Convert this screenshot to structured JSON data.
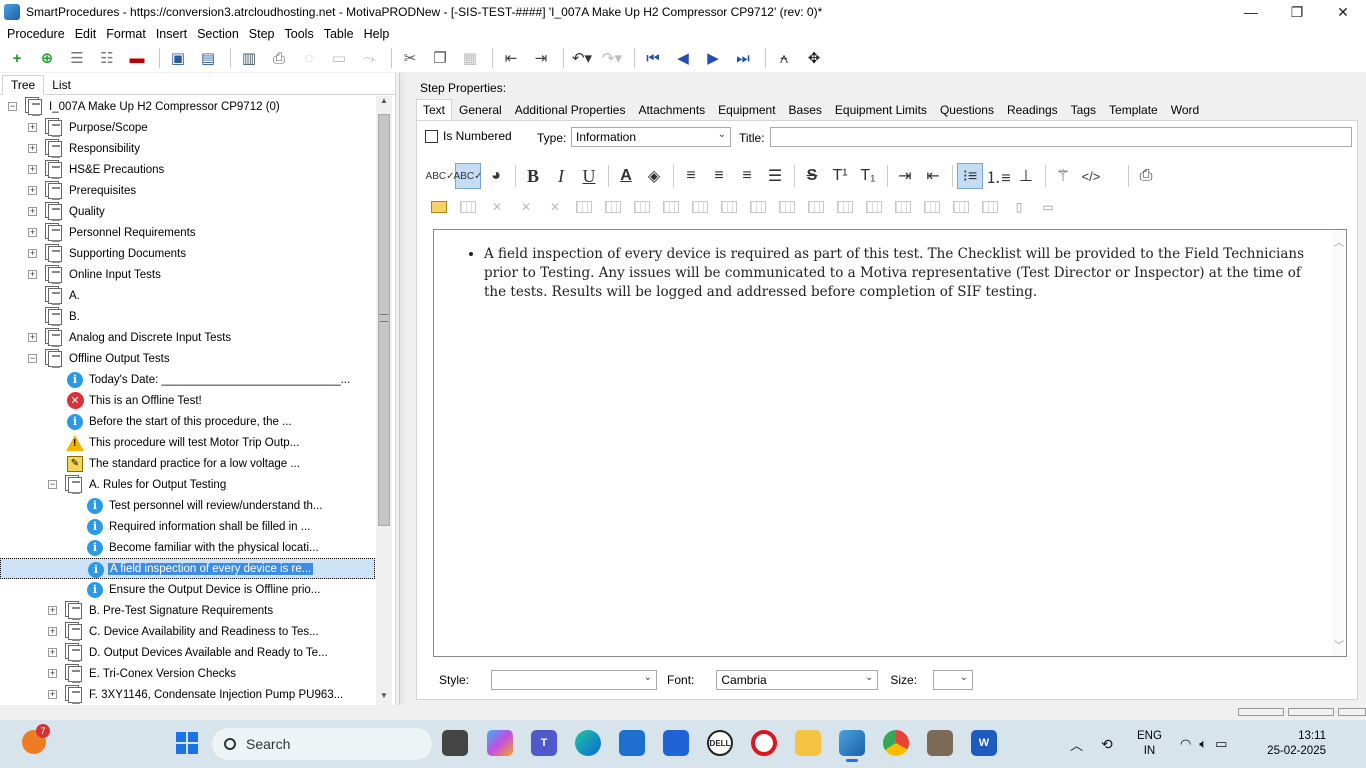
{
  "window": {
    "title": "SmartProcedures - https://conversion3.atrcloudhosting.net - MotivaPRODNew - [-SIS-TEST-####] 'I_007A Make Up H2 Compressor CP9712' (rev: 0)*",
    "minimize": "—",
    "maximize": "❐",
    "close": "✕"
  },
  "menu": [
    "Procedure",
    "Edit",
    "Format",
    "Insert",
    "Section",
    "Step",
    "Tools",
    "Table",
    "Help"
  ],
  "left_pane": {
    "tabs": [
      "Tree",
      "List"
    ],
    "tree": [
      {
        "label": "I_007A Make Up H2 Compressor CP9712 (0)",
        "level": 0,
        "expander": "−",
        "icon": "procedure-icon"
      },
      {
        "label": "Purpose/Scope",
        "level": 1,
        "expander": "+",
        "icon": "section-icon"
      },
      {
        "label": "Responsibility",
        "level": 1,
        "expander": "+",
        "icon": "section-icon"
      },
      {
        "label": "HS&E Precautions",
        "level": 1,
        "expander": "+",
        "icon": "section-icon"
      },
      {
        "label": "Prerequisites",
        "level": 1,
        "expander": "+",
        "icon": "section-icon"
      },
      {
        "label": "Quality",
        "level": 1,
        "expander": "+",
        "icon": "section-icon"
      },
      {
        "label": "Personnel Requirements",
        "level": 1,
        "expander": "+",
        "icon": "section-icon"
      },
      {
        "label": "Supporting Documents",
        "level": 1,
        "expander": "+",
        "icon": "section-icon"
      },
      {
        "label": "Online Input Tests",
        "level": 1,
        "expander": "+",
        "icon": "section-icon"
      },
      {
        "label": "A.",
        "level": 1,
        "expander": "",
        "icon": "section-icon"
      },
      {
        "label": "B.",
        "level": 1,
        "expander": "",
        "icon": "section-icon"
      },
      {
        "label": "Analog and Discrete Input Tests",
        "level": 1,
        "expander": "+",
        "icon": "section-icon"
      },
      {
        "label": "Offline Output Tests",
        "level": 1,
        "expander": "−",
        "icon": "section-icon"
      },
      {
        "label": "Today's Date: ____________________________...",
        "level": 2,
        "expander": "",
        "icon": "info-icon"
      },
      {
        "label": "This is an Offline Test!",
        "level": 2,
        "expander": "",
        "icon": "error-icon"
      },
      {
        "label": "Before the start of this procedure, the ...",
        "level": 2,
        "expander": "",
        "icon": "info-icon"
      },
      {
        "label": "This procedure will test Motor Trip Outp...",
        "level": 2,
        "expander": "",
        "icon": "warning-icon"
      },
      {
        "label": "The standard practice for a low voltage ...",
        "level": 2,
        "expander": "",
        "icon": "tip-icon"
      },
      {
        "label": "A. Rules for Output Testing",
        "level": 2,
        "expander": "−",
        "icon": "section-icon"
      },
      {
        "label": "Test personnel will review/understand th...",
        "level": 3,
        "expander": "",
        "icon": "info-icon"
      },
      {
        "label": "Required information shall be filled in ...",
        "level": 3,
        "expander": "",
        "icon": "info-icon"
      },
      {
        "label": "Become familiar with the physical locati...",
        "level": 3,
        "expander": "",
        "icon": "info-icon"
      },
      {
        "label": "A field inspection of every device is re...",
        "level": 3,
        "expander": "",
        "icon": "info-icon",
        "selected": true
      },
      {
        "label": "Ensure the Output Device is Offline prio...",
        "level": 3,
        "expander": "",
        "icon": "info-icon"
      },
      {
        "label": "B. Pre-Test Signature Requirements",
        "level": 2,
        "expander": "+",
        "icon": "section-icon"
      },
      {
        "label": "C. Device Availability and Readiness to Tes...",
        "level": 2,
        "expander": "+",
        "icon": "section-icon"
      },
      {
        "label": "D. Output Devices Available and Ready to Te...",
        "level": 2,
        "expander": "+",
        "icon": "section-icon"
      },
      {
        "label": "E. Tri-Conex Version Checks",
        "level": 2,
        "expander": "+",
        "icon": "section-icon"
      },
      {
        "label": "F. 3XY1146, Condensate Injection Pump PU963...",
        "level": 2,
        "expander": "+",
        "icon": "section-icon"
      }
    ]
  },
  "right_pane": {
    "heading": "Step Properties:",
    "tabs": [
      "Text",
      "General",
      "Additional Properties",
      "Attachments",
      "Equipment",
      "Bases",
      "Equipment Limits",
      "Questions",
      "Readings",
      "Tags",
      "Template",
      "Word"
    ],
    "active_tab": "Text",
    "is_numbered_label": "Is Numbered",
    "type_label": "Type:",
    "type_value": "Information",
    "title_label": "Title:",
    "title_value": "",
    "editor_text": "A field inspection of every device is required as part of this test. The Checklist will be provided to the Field Technicians prior to Testing. Any issues will be communicated to a Motiva representative (Test Director or Inspector) at the time of the tests. Results will be logged and addressed before completion of SIF testing.",
    "style_label": "Style:",
    "style_value": "",
    "font_label": "Font:",
    "font_value": "Cambria",
    "size_label": "Size:",
    "size_value": ""
  },
  "taskbar": {
    "weather_badge": "7",
    "search_placeholder": "Search",
    "lang_line1": "ENG",
    "lang_line2": "IN",
    "time": "13:11",
    "date": "25-02-2025"
  }
}
